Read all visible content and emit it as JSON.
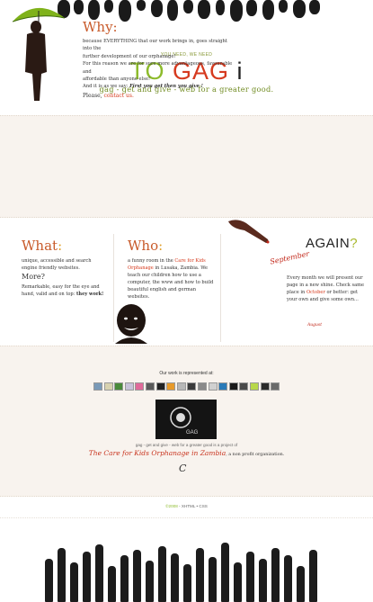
{
  "header": {
    "tagline_small": "YOU NEED, WE NEED",
    "logo_to": "TO",
    "logo_gag": "GAG",
    "logo_i": "i",
    "slogan": "gag - get and give - web for a greater good."
  },
  "why": {
    "title": "Why:",
    "lines": [
      "because EVERYTHING that our work brings in, goes straight into the",
      "further development of our orphanage!",
      "For this reason we are for sure more advantageous, favourable and",
      "affordable than anyone else!"
    ],
    "last_line_prefix": "And it is as we say:",
    "last_line_em": "First you get then you give !",
    "please": "Please,",
    "contact": "contact us."
  },
  "what": {
    "title": "What",
    "colon": ":",
    "text": "unique, accessible and search engine friendly websites.",
    "more_title": "More?",
    "more_text": "Remarkable, easy for the eye and hand, valid and on top:",
    "more_bold": "they work!"
  },
  "who": {
    "title": "Who",
    "colon": ":",
    "prefix": "a funny room in the",
    "link": "Care for Kids Orphanage",
    "rest": "in Lusaka, Zambia. We teach our children how to use a computer, the www and how to build beautiful english and german websites."
  },
  "again": {
    "word": "AGAIN",
    "q": "?",
    "month": "September",
    "text_1": "Every month we will present our page in a new shine. Check same place in",
    "link": "October",
    "text_2": "or better: get your own and give some own...",
    "previous": "August"
  },
  "represented": {
    "title": "Our work is represented at:",
    "badges": [
      "#7a9ab8",
      "#d8d2b0",
      "#4a8a3a",
      "#c8c2d8",
      "#e06a9a",
      "#5a5a5a",
      "#222222",
      "#e89a2a",
      "#b8b8b8",
      "#3a3a3a",
      "#8a8a8a",
      "#d0d0d0",
      "#2a7ab8",
      "#1a1a1a",
      "#4a4a4a",
      "#b8d84a",
      "#2a2a2a",
      "#6a6a6a"
    ],
    "gag_sub": "gag - get and give - web for a greater good is a project of",
    "care_link": "The Care for Kids Orphanage in Zambia",
    "care_suffix": ", a non profit organization.",
    "c_mark": "C"
  },
  "footer": {
    "year": "©2008",
    "rest": "- XHTML • CSS"
  },
  "colors": {
    "accent_green": "#8dbb2c",
    "accent_red": "#d63a1f",
    "title_orange": "#c85a2a",
    "band_bg": "#f8f3ee"
  }
}
